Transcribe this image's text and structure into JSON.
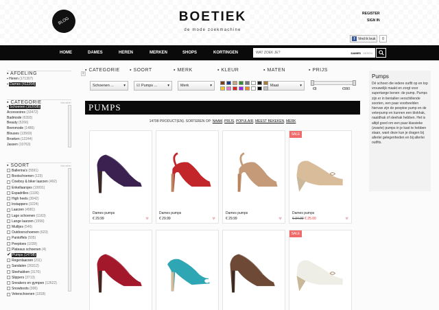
{
  "header": {
    "blog_label": "BLOG",
    "logo": "BOETIEK",
    "tagline": "de mode zoekmachine",
    "register": "REGISTER",
    "signin": "SIGN IN",
    "fb_like": "Vind ik leuk",
    "fb_count": "0"
  },
  "nav": {
    "items": [
      "HOME",
      "DAMES",
      "HEREN",
      "MERKEN",
      "SHOPS",
      "KORTINGEN"
    ],
    "search_placeholder": "WAT ZOEK JE?",
    "search_opt_dames": "DAMES",
    "search_opt_heren": "HEREN"
  },
  "sidebar": {
    "afdeling": {
      "title": "AFDELING",
      "items": [
        {
          "label": "Heren",
          "count": "(171307)",
          "selected": false
        },
        {
          "label": "Dames",
          "count": "(412264)",
          "selected": true
        }
      ]
    },
    "categorie": {
      "title": "CATEGORIE",
      "reset": "herstel",
      "items": [
        {
          "label": "Schoenen",
          "count": "(162038)",
          "selected": true
        },
        {
          "label": "Accessoires",
          "count": "(33472)"
        },
        {
          "label": "Badmode",
          "count": "(6393)"
        },
        {
          "label": "Beauty",
          "count": "(5266)"
        },
        {
          "label": "Beenmode",
          "count": "(1486)"
        },
        {
          "label": "Blouses",
          "count": "(13569)"
        },
        {
          "label": "Broeken",
          "count": "(12244)"
        },
        {
          "label": "Jassen",
          "count": "(10763)"
        }
      ]
    },
    "soort": {
      "title": "SOORT",
      "reset": "herstel",
      "items": [
        {
          "label": "Ballerina's",
          "count": "(5591)"
        },
        {
          "label": "Bootschoenen",
          "count": "(123)"
        },
        {
          "label": "Cowboy & biker laarzen",
          "count": "(492)"
        },
        {
          "label": "Enkellaarsjes",
          "count": "(10091)"
        },
        {
          "label": "Espadrilles",
          "count": "(1106)"
        },
        {
          "label": "High heels",
          "count": "(3042)"
        },
        {
          "label": "Instappers",
          "count": "(3224)"
        },
        {
          "label": "Laarzen",
          "count": "(4981)"
        },
        {
          "label": "Lage schoenen",
          "count": "(1163)"
        },
        {
          "label": "Lange laarzen",
          "count": "(1556)"
        },
        {
          "label": "Muiltjes",
          "count": "(546)"
        },
        {
          "label": "Outdoorschoenen",
          "count": "(623)"
        },
        {
          "label": "Pantoffels",
          "count": "(505)"
        },
        {
          "label": "Peeptoes",
          "count": "(1039)"
        },
        {
          "label": "Plateaus schoenen",
          "count": "(4)"
        },
        {
          "label": "Pumps",
          "count": "(14798)",
          "selected": true
        },
        {
          "label": "Regenlaarzen",
          "count": "(211)"
        },
        {
          "label": "Sandalen",
          "count": "(20312)"
        },
        {
          "label": "Sleehakken",
          "count": "(3170)"
        },
        {
          "label": "Slippers",
          "count": "(3713)"
        },
        {
          "label": "Sneakers en gympen",
          "count": "(12622)"
        },
        {
          "label": "Snowboots",
          "count": "(306)"
        },
        {
          "label": "Veterschoenen",
          "count": "(1818)"
        }
      ]
    }
  },
  "filters": {
    "categorie": {
      "title": "CATEGORIE",
      "value": "Schoenen ..."
    },
    "soort": {
      "title": "SOORT",
      "value": "Pumps ..."
    },
    "merk": {
      "title": "MERK",
      "value": "Merk"
    },
    "kleur": {
      "title": "KLEUR"
    },
    "maten": {
      "title": "MATEN",
      "value": "Maat"
    },
    "prijs": {
      "title": "PRIJS",
      "min": "€8",
      "max": "€990"
    },
    "colors": [
      "#7a3d1c",
      "#1a3c8c",
      "#c8a57c",
      "#2d8f2d",
      "#777777",
      "#ffffff",
      "#222222",
      "#aa7a3a",
      "#f4c430",
      "#e87ac8",
      "#d22",
      "#a020f0",
      "#f58a1f",
      "#ffffff",
      "#000000",
      "#c0c0c0"
    ]
  },
  "main": {
    "heading": "PUMPS",
    "result_count": "14798 PRODUCT(EN). SORTEREN OP:",
    "sort_options": [
      "NAAM",
      "PRIJS",
      "POPULAIR",
      "MEEST BEKEKEN",
      "MERK"
    ]
  },
  "products": [
    {
      "name": "Dames pumps",
      "price": "€ 29.99",
      "color": "#3b2150",
      "style": "pump"
    },
    {
      "name": "Dames pumps",
      "price": "€ 29.99",
      "color": "#c2262b",
      "style": "sling"
    },
    {
      "name": "Dames pumps",
      "price": "€ 29.99",
      "color": "#c49a78",
      "style": "sling"
    },
    {
      "name": "Dames pumps",
      "price_old": "€ 34.99",
      "price_new": "€ 25.00",
      "sale": "SALE",
      "color": "#d9bc9a",
      "style": "wedge"
    },
    {
      "color": "#a3192b",
      "style": "pump"
    },
    {
      "color": "#2fa6b4",
      "style": "peep"
    },
    {
      "color": "#6e4a36",
      "style": "pump"
    },
    {
      "sale": "SALE",
      "color": "#efeee6",
      "style": "wedge"
    }
  ],
  "info": {
    "title": "Pumps",
    "text": "Dé schoen die iedere outfit op en top vrouwelijk maakt en zorgt voor supertange benen: de pump. Pumps zijn er in tientallen verschillende soorten, een paar voorbeelden hiervan zijn de peeptoe pump en de veterpump en kunnen een blokhak, naaldhak of sleehak hebben. Het is altijd goed om een paar klassieke (zwarte) pumps in je kast te hebben staan, want deze kun je dragen bij allerlei gelegenheden en bij allerlei outfits."
  }
}
